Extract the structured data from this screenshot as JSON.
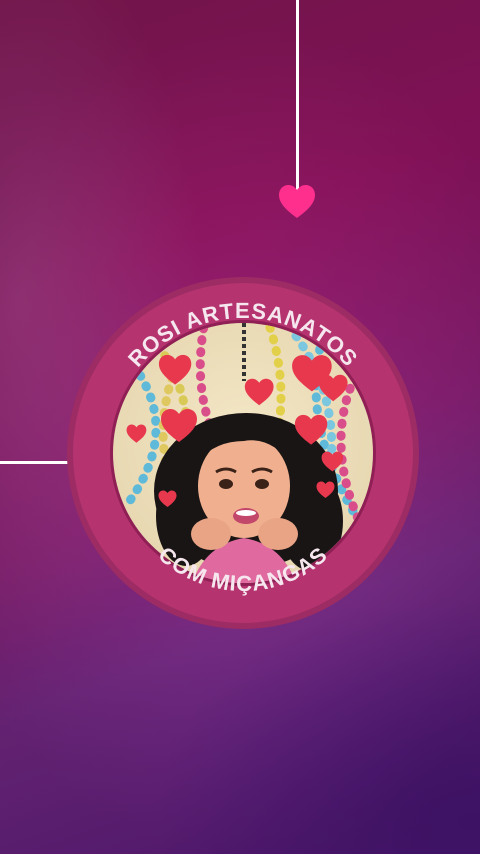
{
  "badge": {
    "top_text": "ROSI ARTESANATOS",
    "bottom_text": "COM MIÇANGAS"
  },
  "colors": {
    "accent_pink": "#ff2f8e",
    "ring": "#b5336f",
    "ring_dark": "#8f1f55"
  },
  "icons": [
    "heart-icon",
    "avatar-girl"
  ]
}
